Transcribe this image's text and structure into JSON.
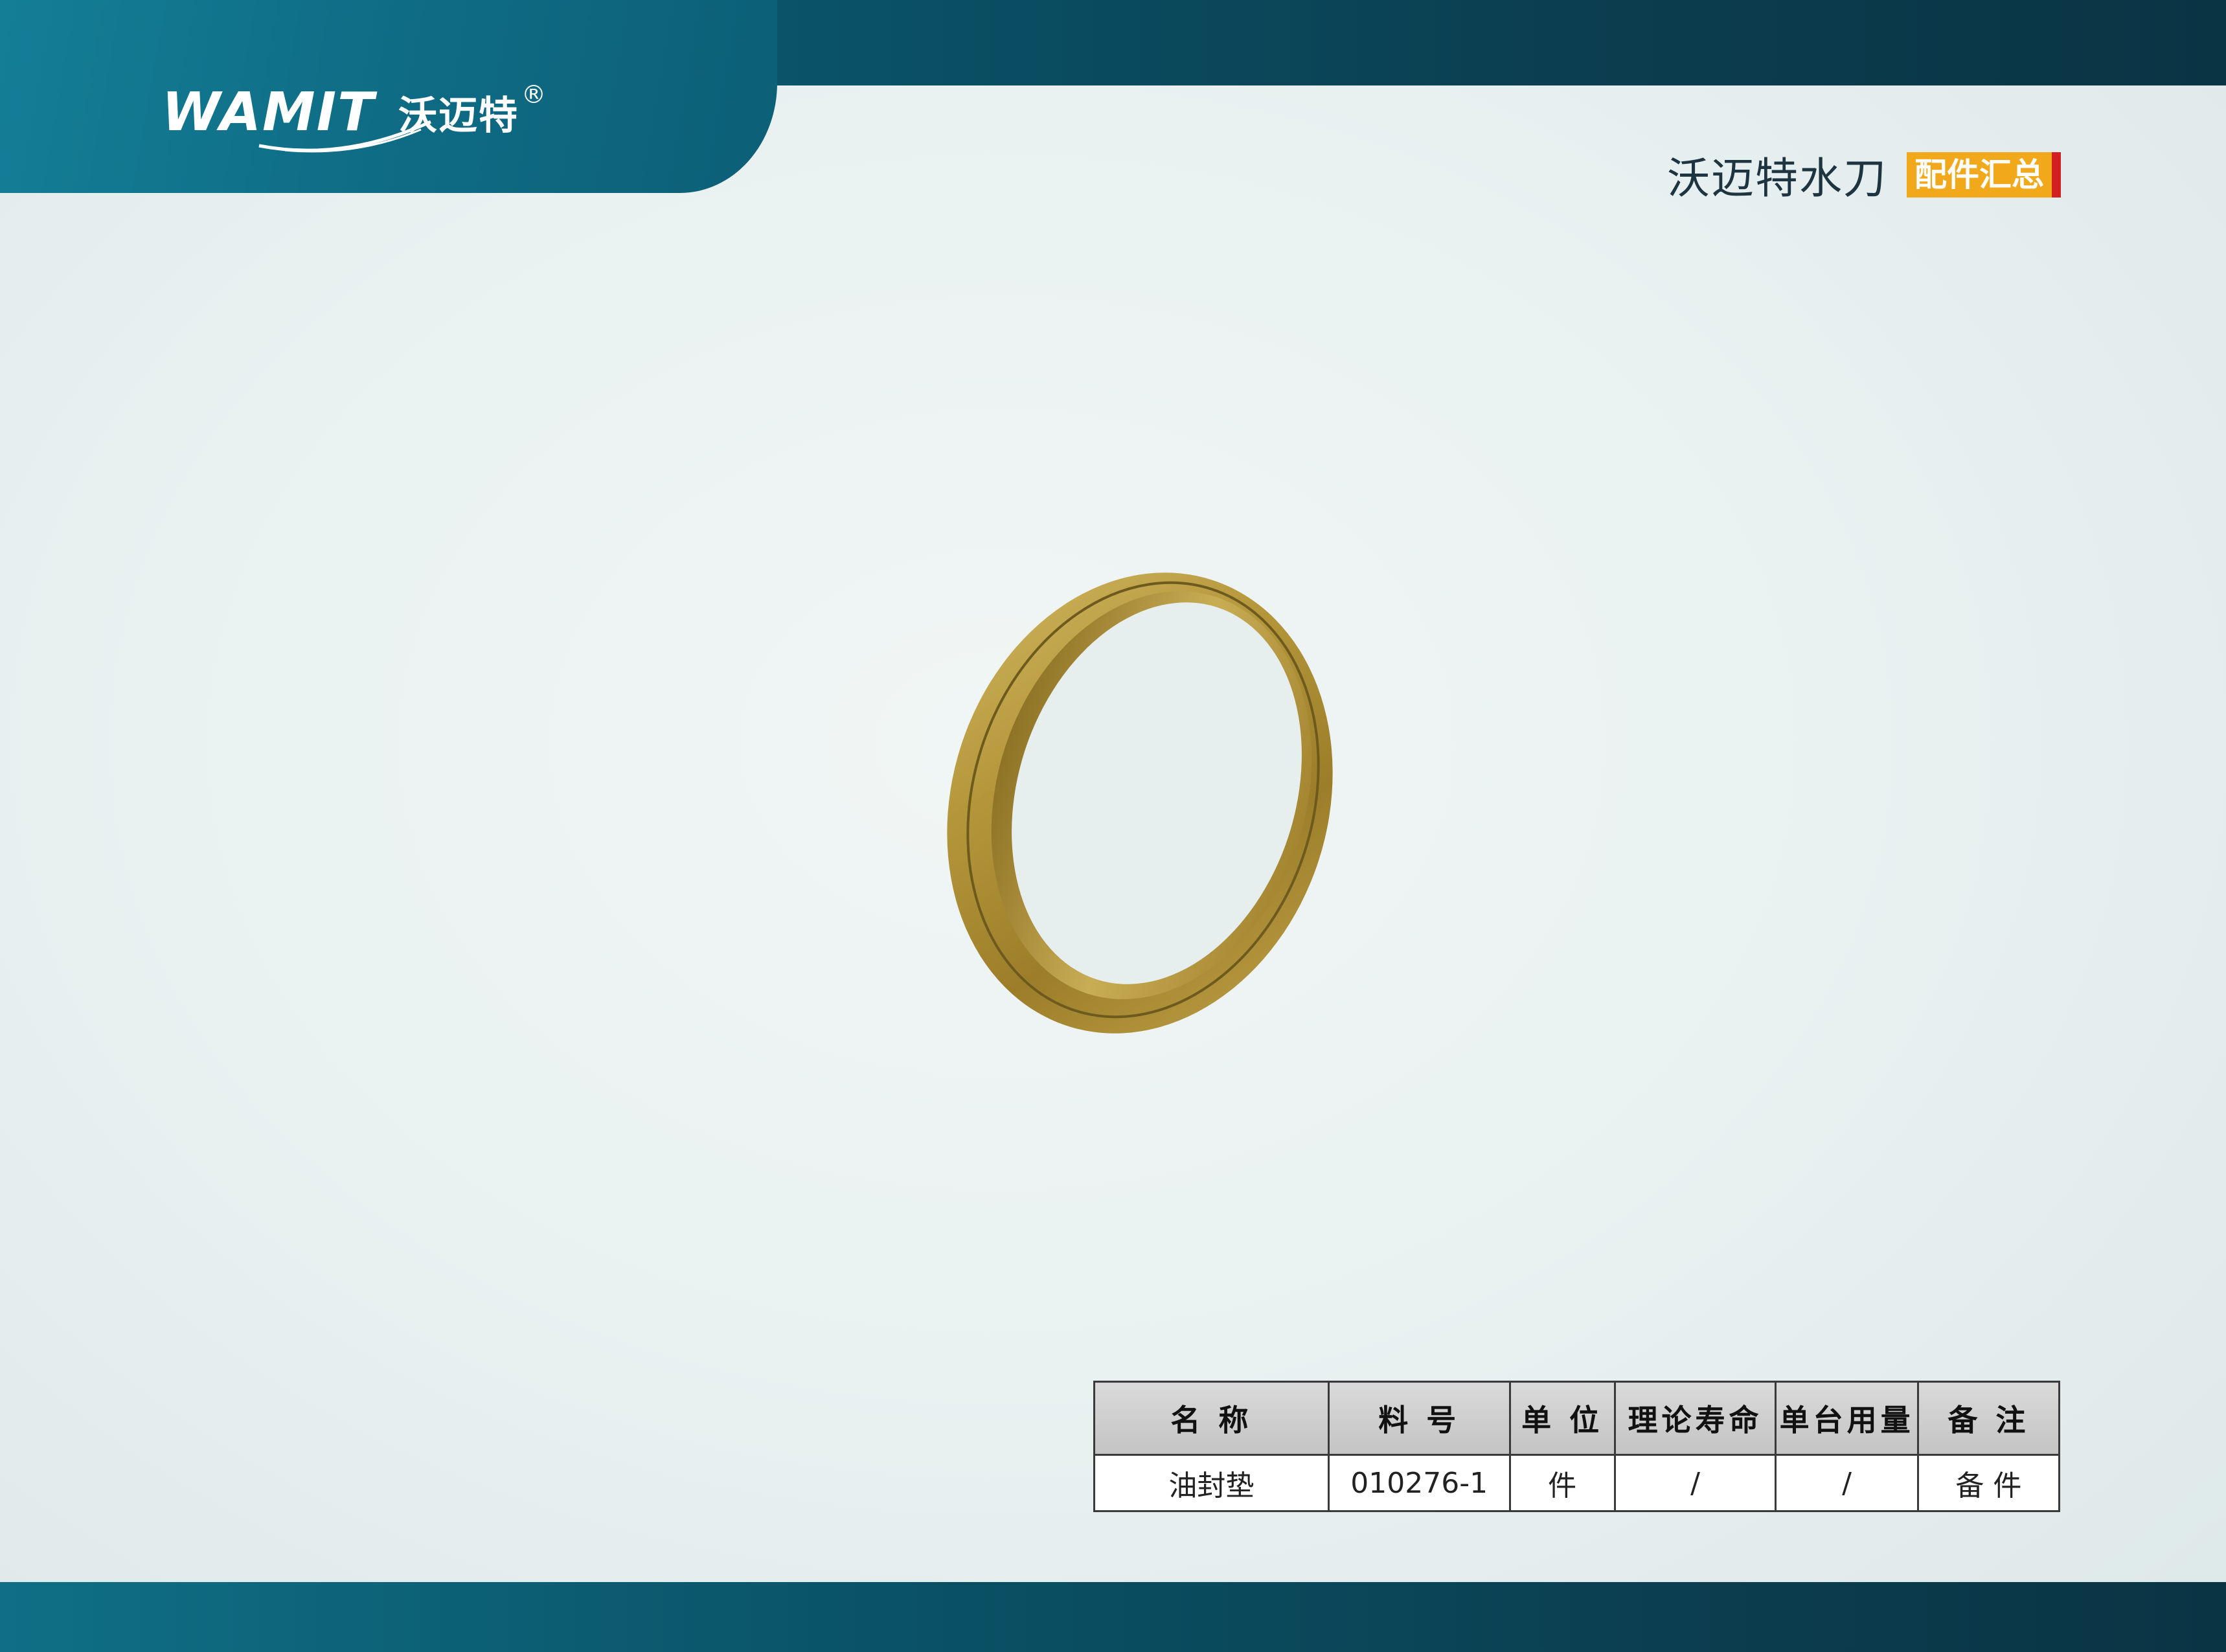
{
  "header": {
    "brand_latin": "WAMIT",
    "brand_cn": "沃迈特",
    "registered_mark": "®",
    "title": "沃迈特水刀",
    "tag": "配件汇总"
  },
  "colors": {
    "band_dark": "#0a3444",
    "band_light": "#0f6f86",
    "tag_orange": "#f2a81b",
    "tag_red": "#d21f1f",
    "brass": "#b89a3c"
  },
  "product": {
    "icon": "brass-ring-image"
  },
  "table": {
    "headers": [
      "名 称",
      "料 号",
      "单 位",
      "理论寿命",
      "单台用量",
      "备 注"
    ],
    "rows": [
      [
        "油封垫",
        "010276-1",
        "件",
        "/",
        "/",
        "备 件"
      ]
    ]
  }
}
